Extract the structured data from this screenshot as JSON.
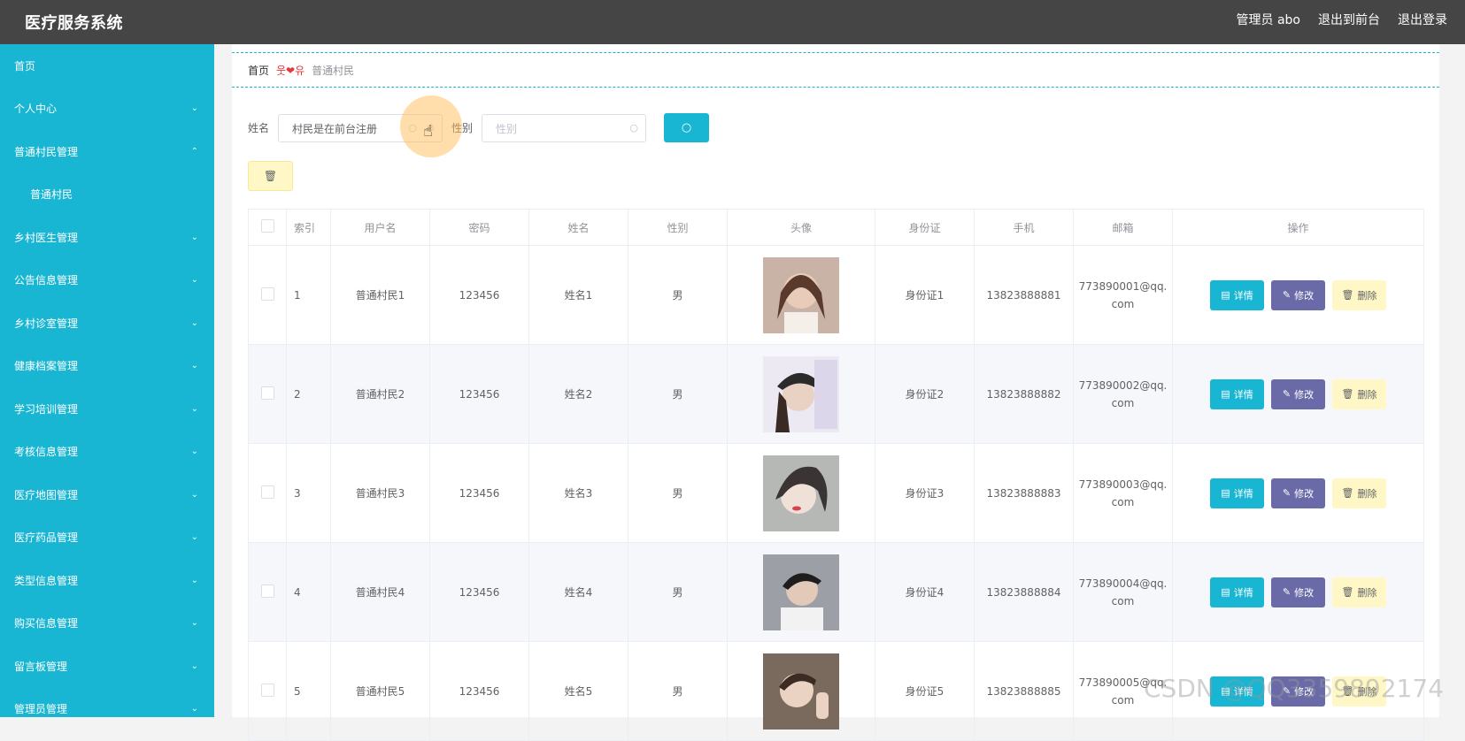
{
  "app": {
    "title": "医疗服务系统"
  },
  "header": {
    "admin_label": "管理员 abo",
    "to_front": "退出到前台",
    "logout": "退出登录"
  },
  "sidebar": {
    "items": [
      {
        "label": "首页"
      },
      {
        "label": "个人中心"
      },
      {
        "label": "普通村民管理"
      },
      {
        "label": "普通村民"
      },
      {
        "label": "乡村医生管理"
      },
      {
        "label": "公告信息管理"
      },
      {
        "label": "乡村诊室管理"
      },
      {
        "label": "健康档案管理"
      },
      {
        "label": "学习培训管理"
      },
      {
        "label": "考核信息管理"
      },
      {
        "label": "医疗地图管理"
      },
      {
        "label": "医疗药品管理"
      },
      {
        "label": "类型信息管理"
      },
      {
        "label": "购买信息管理"
      },
      {
        "label": "留言板管理"
      },
      {
        "label": "管理员管理"
      }
    ]
  },
  "breadcrumb": {
    "home": "首页",
    "current": "普通村民"
  },
  "search": {
    "name_label": "姓名",
    "name_value": "村民是在前台注册",
    "gender_label": "性别",
    "gender_placeholder": "性别"
  },
  "table": {
    "headers": [
      "索引",
      "用户名",
      "密码",
      "姓名",
      "性别",
      "头像",
      "身份证",
      "手机",
      "邮箱",
      "操作"
    ],
    "rows": [
      {
        "index": "1",
        "username": "普通村民1",
        "password": "123456",
        "name": "姓名1",
        "gender": "男",
        "idcard": "身份证1",
        "phone": "13823888881",
        "email_a": "773890001@qq.",
        "email_b": "com"
      },
      {
        "index": "2",
        "username": "普通村民2",
        "password": "123456",
        "name": "姓名2",
        "gender": "男",
        "idcard": "身份证2",
        "phone": "13823888882",
        "email_a": "773890002@qq.",
        "email_b": "com"
      },
      {
        "index": "3",
        "username": "普通村民3",
        "password": "123456",
        "name": "姓名3",
        "gender": "男",
        "idcard": "身份证3",
        "phone": "13823888883",
        "email_a": "773890003@qq.",
        "email_b": "com"
      },
      {
        "index": "4",
        "username": "普通村民4",
        "password": "123456",
        "name": "姓名4",
        "gender": "男",
        "idcard": "身份证4",
        "phone": "13823888884",
        "email_a": "773890004@qq.",
        "email_b": "com"
      },
      {
        "index": "5",
        "username": "普通村民5",
        "password": "123456",
        "name": "姓名5",
        "gender": "男",
        "idcard": "身份证5",
        "phone": "13823888885",
        "email_a": "773890005@qq.",
        "email_b": "com"
      }
    ],
    "actions": {
      "detail": "详情",
      "edit": "修改",
      "delete": "删除"
    }
  },
  "watermark": "CSDN @QQ3359892174",
  "colors": {
    "accent": "#19b6d3",
    "topbar": "#454545",
    "edit": "#6a6aa8",
    "delete": "#fff8c6"
  }
}
